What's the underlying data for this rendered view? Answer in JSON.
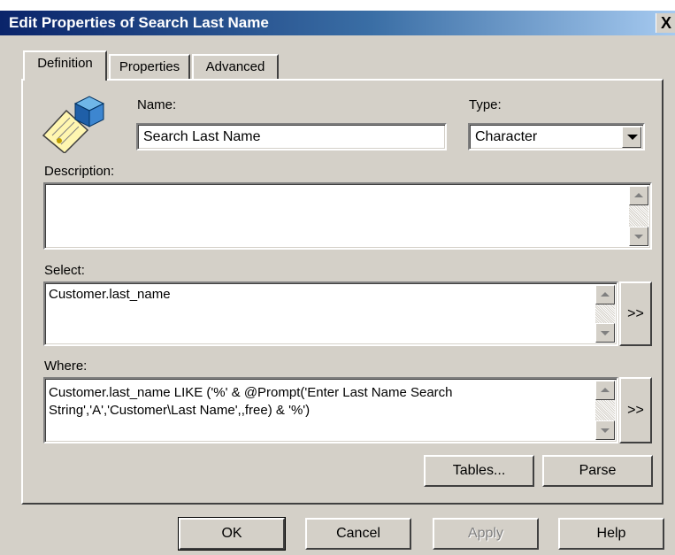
{
  "window": {
    "title": "Edit Properties of Search Last Name",
    "close_glyph": "X"
  },
  "tabs": [
    {
      "label": "Definition",
      "active": true
    },
    {
      "label": "Properties",
      "active": false
    },
    {
      "label": "Advanced",
      "active": false
    }
  ],
  "definition": {
    "icon": "object-icon",
    "name_label": "Name:",
    "name_value": "Search Last Name",
    "type_label": "Type:",
    "type_value": "Character",
    "description_label": "Description:",
    "description_value": "",
    "select_label": "Select:",
    "select_value": "Customer.last_name",
    "select_button": ">>",
    "where_label": "Where:",
    "where_value": "Customer.last_name LIKE ('%' & @Prompt('Enter Last Name Search\nString','A','Customer\\Last Name',,free) & '%')",
    "where_button": ">>",
    "tables_button": "Tables...",
    "parse_button": "Parse"
  },
  "footer": {
    "ok": "OK",
    "cancel": "Cancel",
    "apply": "Apply",
    "help": "Help"
  },
  "colors": {
    "title_bar_start": "#0a246a",
    "title_bar_end": "#a6caf0",
    "face": "#d4d0c8"
  }
}
